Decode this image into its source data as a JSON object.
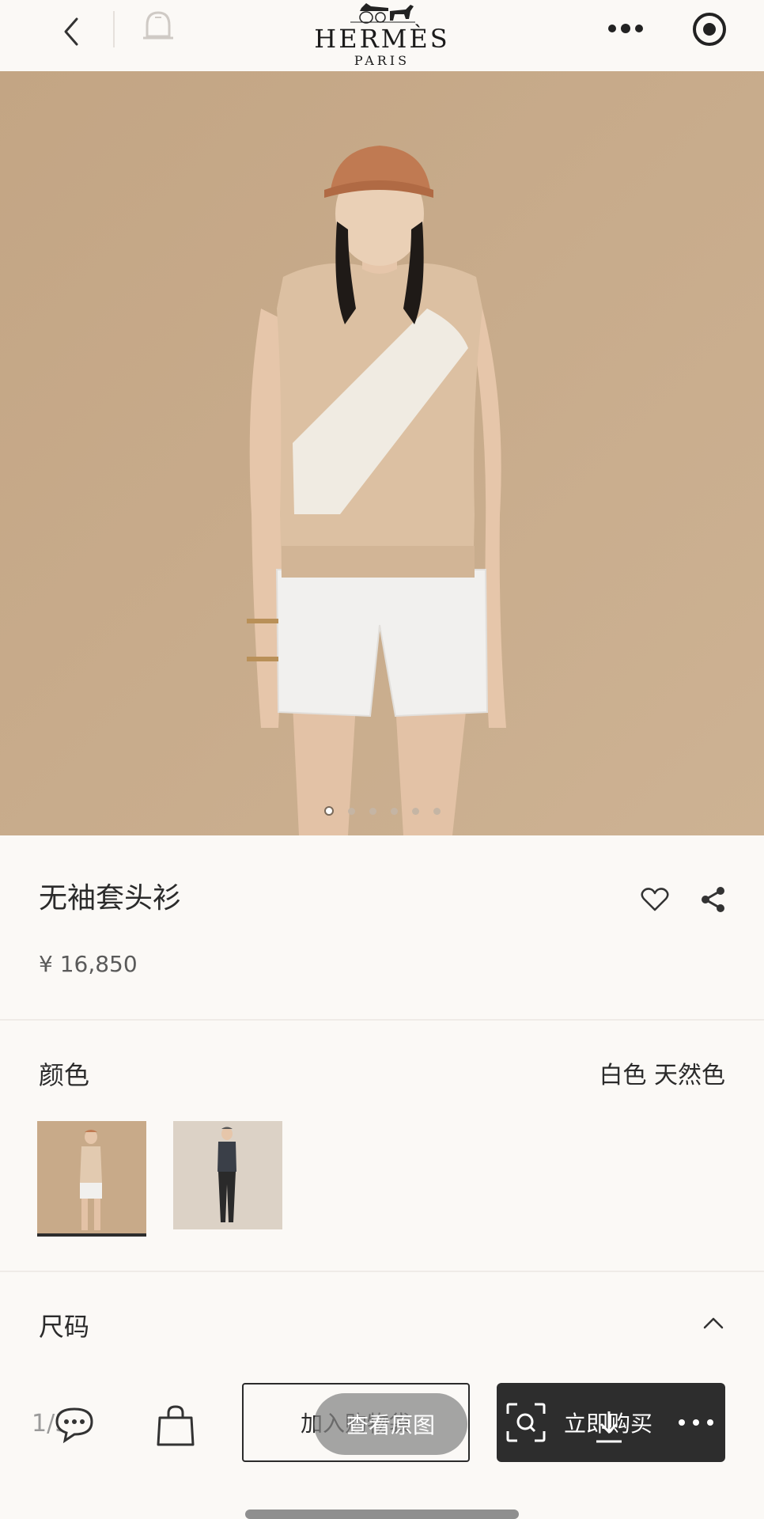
{
  "header": {
    "logo_main": "HERMÈS",
    "logo_sub": "PARIS",
    "icons": [
      "back-arrow-icon",
      "bell-icon",
      "more-icon",
      "target-icon"
    ]
  },
  "hero": {
    "image": "model-in-sleeveless-sweater-photo",
    "carousel_count": 6,
    "carousel_active": 1
  },
  "product": {
    "title": "无袖套头衫",
    "price": "¥ 16,850"
  },
  "color": {
    "label": "颜色",
    "value": "白色 天然色",
    "swatches": [
      "swatch-beige-outfit",
      "swatch-dark-outfit"
    ]
  },
  "size": {
    "label": "尺码"
  },
  "bottom_bar": {
    "page_indicator": "1/5",
    "add_to_cart": "加入购物袋",
    "view_original": "查看原图",
    "buy_now": "立即购买"
  },
  "colors": {
    "background": "#fbf9f6",
    "hero_bg": "#c9ab8a",
    "dark_button": "#2d2d2d"
  }
}
